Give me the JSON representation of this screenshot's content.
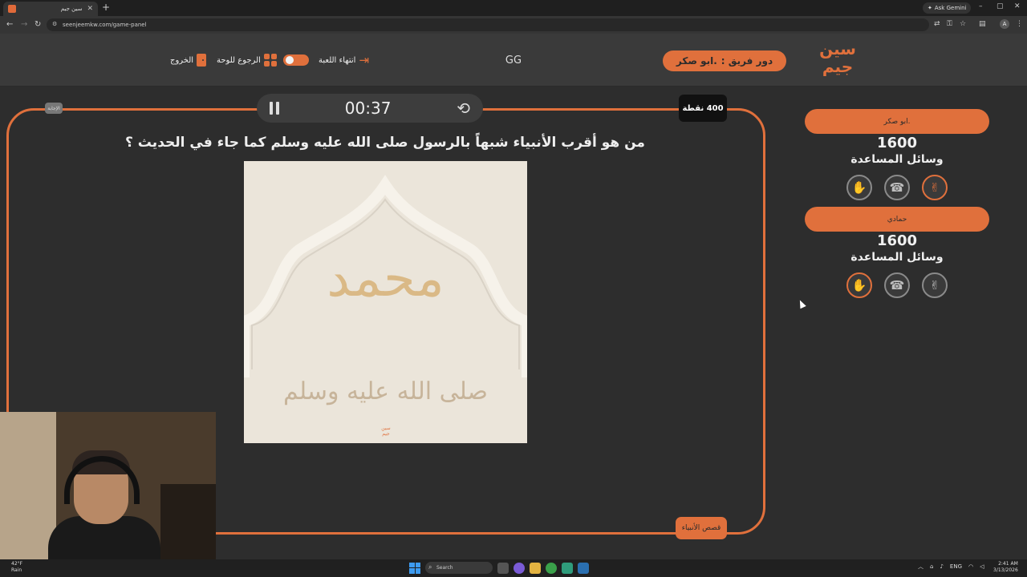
{
  "browser": {
    "tab_title": "سين جيم",
    "url": "seenjeemkw.com/game-panel",
    "ask_gemini": "Ask Gemini",
    "profile_initial": "A"
  },
  "header": {
    "logo_line1": "سين",
    "logo_line2": "جيم",
    "turn_prefix": "دور فريق :",
    "turn_team": ".ابو صكر",
    "gg": "GG",
    "end_game": "انتهاء اللعبة",
    "back_to_board": "الرجوع للوحة",
    "exit": "الخروج"
  },
  "board": {
    "timer": "00:37",
    "points": "400 نقطة",
    "small_tag": "الإجابة",
    "question": "من هو أقرب الأنبياء شبهاً بالرسول صلى الله عليه وسلم كما جاء في الحديث ؟",
    "image_name": "محمد",
    "image_sub": "صلى الله عليه وسلم",
    "image_logo": "سين جيم",
    "category": "قصص الأنبياء"
  },
  "teams": [
    {
      "name": ".ابو صكر",
      "score": "1600",
      "help_label": "وسائل المساعدة"
    },
    {
      "name": "حمادي",
      "score": "1600",
      "help_label": "وسائل المساعدة"
    }
  ],
  "taskbar": {
    "temp": "42°F",
    "weather": "Rain",
    "search": "Search",
    "lang": "ENG",
    "time": "2:41 AM",
    "date": "3/13/2026"
  },
  "colors": {
    "accent": "#e0703c",
    "background": "#2d2d2d",
    "header": "#3a3a3a"
  }
}
